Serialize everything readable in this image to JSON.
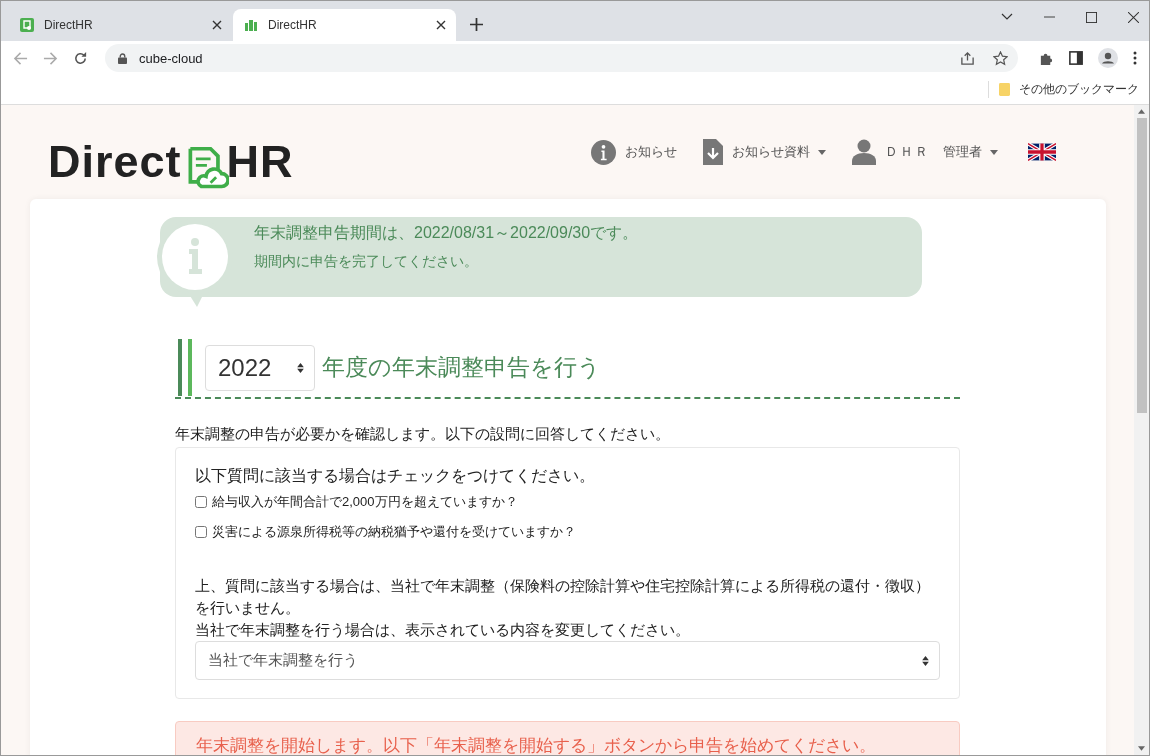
{
  "browser": {
    "tabs": [
      {
        "title": "DirectHR",
        "selected": false
      },
      {
        "title": "DirectHR",
        "selected": true
      }
    ],
    "address": "cube-cloud",
    "bookmarks": [
      "その他のブックマーク"
    ]
  },
  "header": {
    "logo": [
      "Direct",
      "HR"
    ],
    "nav": [
      {
        "kind": "info",
        "label": "お知らせ",
        "dropdown": false
      },
      {
        "kind": "download",
        "label": "お知らせ資料",
        "dropdown": true
      },
      {
        "kind": "user",
        "name": "ＤＨＲ",
        "label": "管理者",
        "dropdown": true
      },
      {
        "kind": "flag"
      }
    ]
  },
  "notice": {
    "title": "年末調整申告期間は、2022/08/31～2022/09/30です。",
    "text": "期間内に申告を完了してください。"
  },
  "section": {
    "year": "2022",
    "heading": "年度の年末調整申告を行う",
    "intro": "年末調整の申告が必要かを確認します。以下の設問に回答してください。",
    "panel": {
      "prompt": "以下質問に該当する場合はチェックをつけてください。",
      "questions": [
        {
          "label": "給与収入が年間合計で2,000万円を超えていますか？",
          "checked": false
        },
        {
          "label": "災害による源泉所得税等の納税猶予や還付を受けていますか？",
          "checked": false
        }
      ],
      "note": [
        "上、質問に該当する場合は、当社で年末調整（保険料の控除計算や住宅控除計算による所得税の還付・徴収）を行いません。",
        "当社で年末調整を行う場合は、表示されている内容を変更してください。"
      ],
      "select": "当社で年末調整を行う"
    },
    "alert": "年末調整を開始します。以下「年末調整を開始する」ボタンから申告を始めてください。"
  }
}
